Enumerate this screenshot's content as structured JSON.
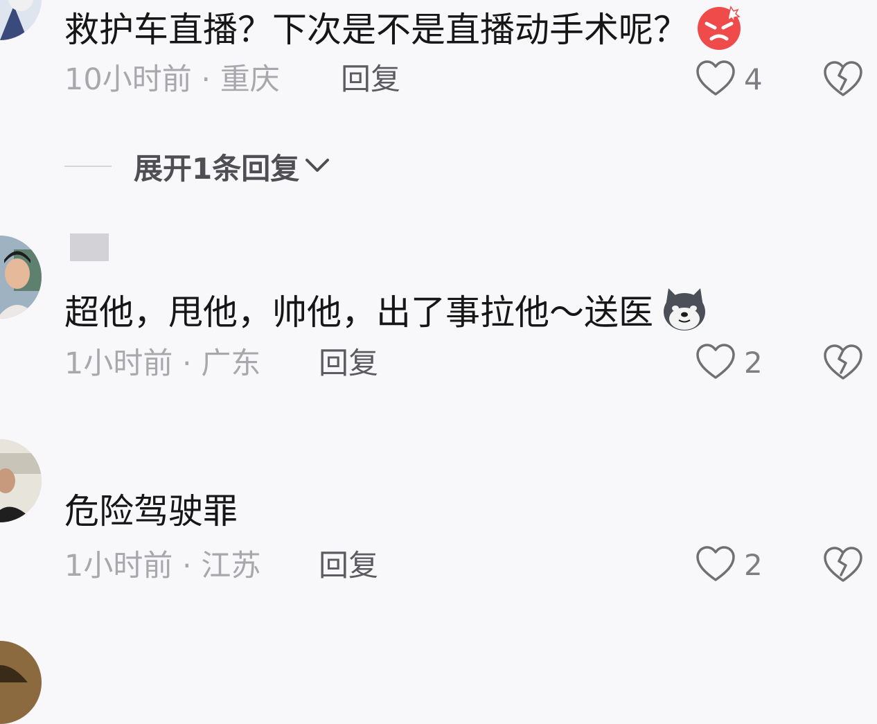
{
  "comments": [
    {
      "text": "救护车直播？下次是不是直播动手术呢？",
      "emoji": "angry-face",
      "meta": "10小时前 · 重庆",
      "reply_label": "回复",
      "likes": "4"
    },
    {
      "text": "超他，甩他，帅他，出了事拉他～送医",
      "emoji": "dog-face",
      "meta": "1小时前 · 广东",
      "reply_label": "回复",
      "likes": "2"
    },
    {
      "text": "危险驾驶罪",
      "meta": "1小时前 · 江苏",
      "reply_label": "回复",
      "likes": "2"
    }
  ],
  "expand_replies": {
    "label": "展开1条回复"
  },
  "colors": {
    "background": "#f8f8fa",
    "text": "#161616",
    "meta": "#a7a7ac",
    "icon": "#6f6f74"
  }
}
